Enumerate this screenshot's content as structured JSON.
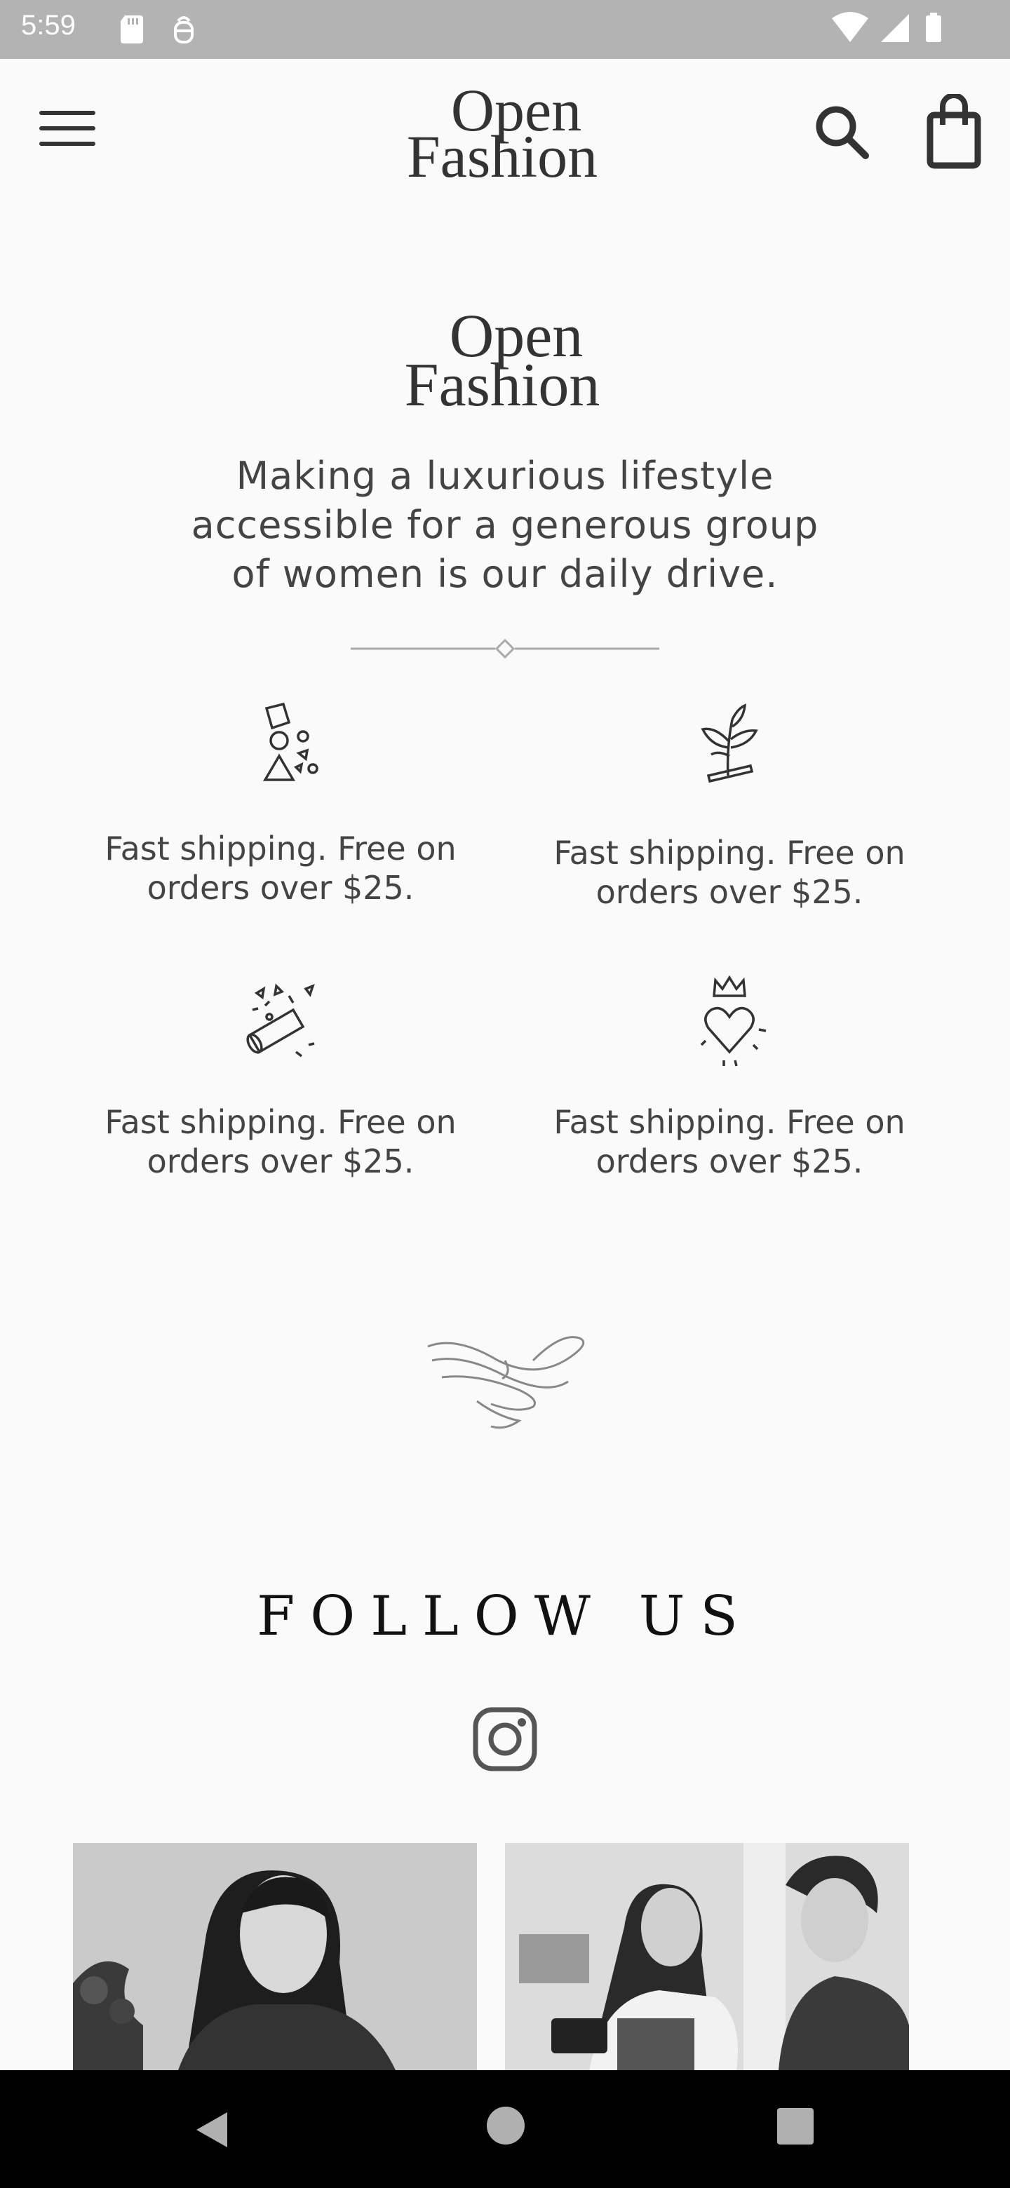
{
  "status_bar": {
    "time": "5:59",
    "icons_left": [
      "sd-card-icon",
      "bug-icon"
    ],
    "icons_right": [
      "wifi-icon",
      "cell-signal-icon",
      "battery-icon"
    ]
  },
  "app_bar": {
    "logo_line1": "Open",
    "logo_line2": "Fashion",
    "menu_icon": "hamburger-menu-icon",
    "search_icon": "search-icon",
    "bag_icon": "shopping-bag-icon"
  },
  "hero": {
    "logo_line1": "Open",
    "logo_line2": "Fashion",
    "tagline_lines": [
      "Making a luxurious lifestyle",
      "accessible for a generous group",
      "of women is our daily drive."
    ]
  },
  "features": [
    {
      "icon": "shapes-icon",
      "line1": "Fast shipping. Free on",
      "line2": "orders over $25."
    },
    {
      "icon": "plant-icon",
      "line1": "Fast shipping. Free on",
      "line2": "orders over $25."
    },
    {
      "icon": "cracker-icon",
      "line1": "Fast shipping. Free on",
      "line2": "orders over $25."
    },
    {
      "icon": "crowned-heart-icon",
      "line1": "Fast shipping. Free on",
      "line2": "orders over $25."
    }
  ],
  "follow": {
    "title": "FOLLOW US",
    "icon": "instagram-icon",
    "photos": [
      "photo-woman-smiling",
      "photo-couple-with-camera"
    ]
  },
  "nav_bar": {
    "icons": [
      "back-icon",
      "home-icon",
      "recents-icon"
    ]
  }
}
